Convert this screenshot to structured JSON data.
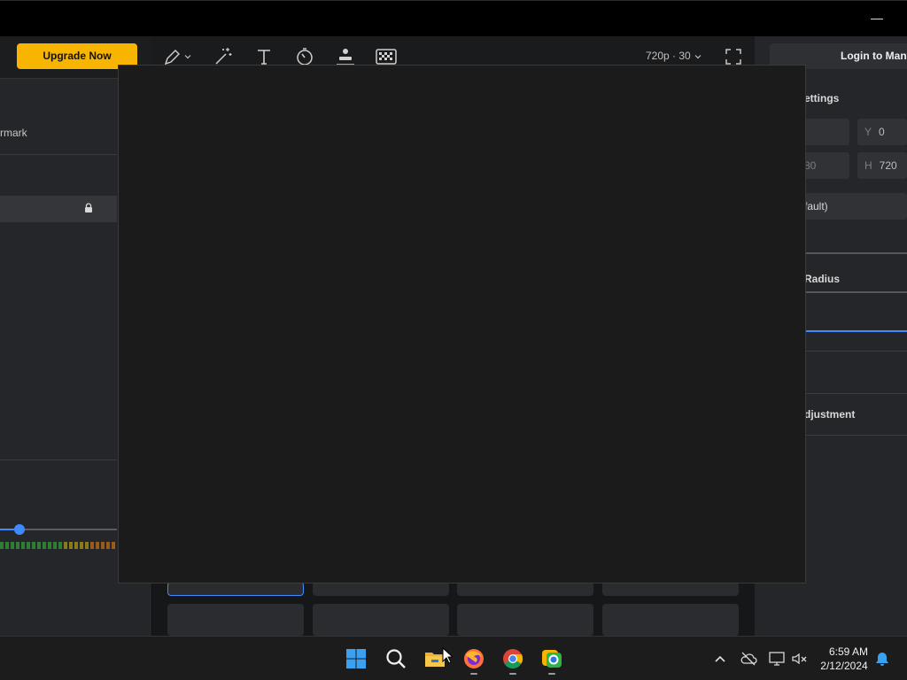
{
  "window": {
    "minimize_glyph": "—"
  },
  "left_panel": {
    "upgrade_label": "Upgrade Now",
    "watermark_label": "rmark",
    "lock_icon": "lock-icon"
  },
  "toolbar": {
    "tools": [
      "pen-icon",
      "magic-wand-icon",
      "text-icon",
      "timer-icon",
      "stamp-icon",
      "mosaic-icon"
    ],
    "quality_label": "720p · 30",
    "fullscreen_icon": "fullscreen-icon"
  },
  "right_panel": {
    "login_label": "Login to Manyc",
    "settings_label": "ettings",
    "y_key": "Y",
    "y_value": "0",
    "w_value": "80",
    "h_key": "H",
    "h_value": "720",
    "mode_value": "fault)",
    "radius_label": "Radius",
    "adjustment_label": "djustment"
  },
  "taskbar": {
    "apps": [
      "windows-start-icon",
      "search-icon",
      "file-explorer-icon",
      "firefox-icon",
      "chrome-icon",
      "screen-recorder-icon"
    ],
    "tray": [
      "chevron-up-icon",
      "cloud-offline-icon",
      "display-icon",
      "volume-muted-icon",
      "notification-bell-icon"
    ],
    "time": "6:59 AM",
    "date": "2/12/2024"
  },
  "colors": {
    "accent_yellow": "#f7b500",
    "accent_blue": "#3d8bff",
    "modal_bg": "#1b1b1b"
  }
}
